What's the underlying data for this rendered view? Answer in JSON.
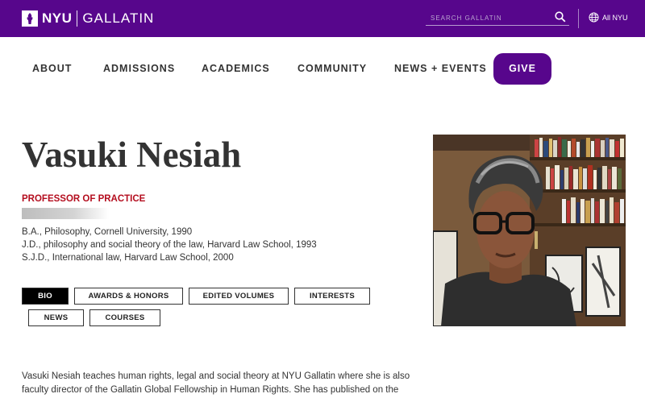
{
  "header": {
    "logo_nyu": "NYU",
    "logo_gallatin": "GALLATIN",
    "search_placeholder": "SEARCH GALLATIN",
    "all_nyu": "All NYU",
    "brand_color": "#57068c"
  },
  "nav": {
    "items": [
      "ABOUT",
      "ADMISSIONS",
      "ACADEMICS",
      "COMMUNITY",
      "NEWS + EVENTS"
    ],
    "give": "GIVE"
  },
  "profile": {
    "name": "Vasuki Nesiah",
    "title": "PROFESSOR OF PRACTICE",
    "degrees": [
      "B.A., Philosophy, Cornell University, 1990",
      "J.D., philosophy and social theory of the law, Harvard Law School, 1993",
      "S.J.D., International law, Harvard Law School, 2000"
    ],
    "title_color": "#b40d1e"
  },
  "tabs": [
    "BIO",
    "AWARDS & HONORS",
    "EDITED VOLUMES",
    "INTERESTS",
    "NEWS",
    "COURSES"
  ],
  "bio": {
    "lines": [
      "Vasuki Nesiah teaches human rights, legal and social theory at NYU Gallatin where she is also",
      "faculty director of the Gallatin Global Fellowship in Human Rights. She has published on the history"
    ]
  }
}
